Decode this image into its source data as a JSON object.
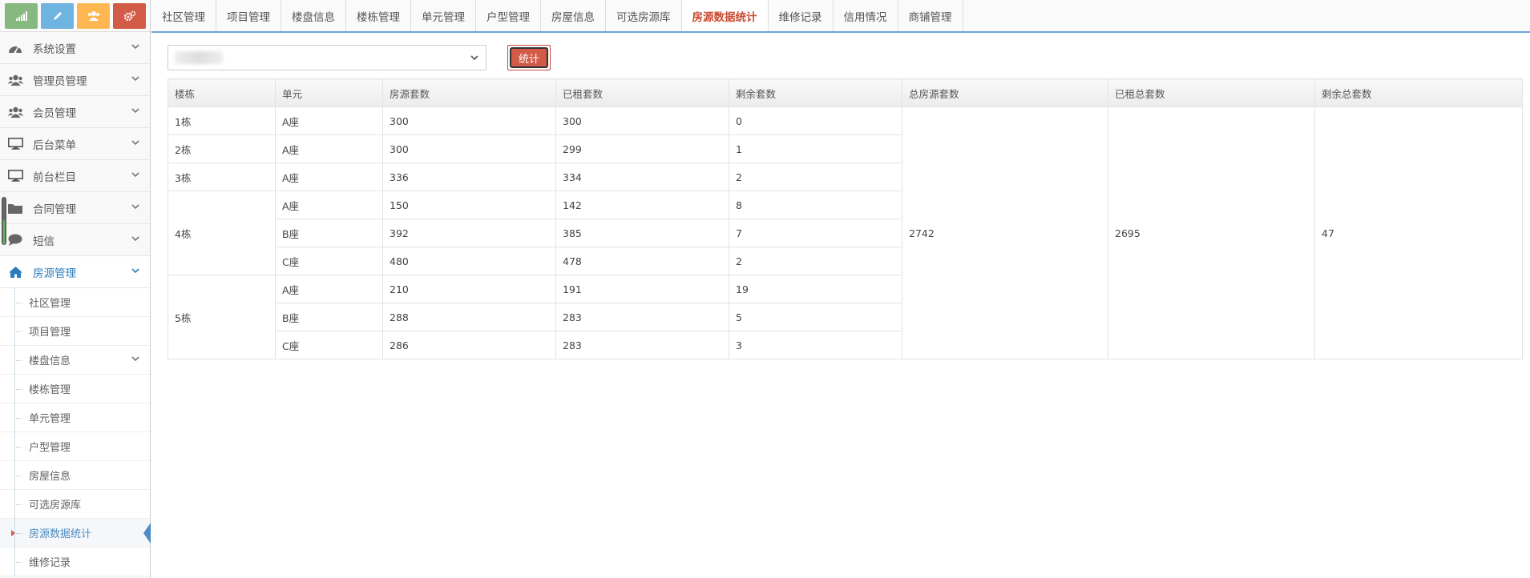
{
  "sidebar": {
    "menu": [
      {
        "label": "系统设置",
        "icon": "dashboard-icon"
      },
      {
        "label": "管理员管理",
        "icon": "users-icon"
      },
      {
        "label": "会员管理",
        "icon": "users-icon"
      },
      {
        "label": "后台菜单",
        "icon": "desktop-icon"
      },
      {
        "label": "前台栏目",
        "icon": "desktop-icon"
      },
      {
        "label": "合同管理",
        "icon": "folder-icon"
      },
      {
        "label": "短信",
        "icon": "comment-icon"
      },
      {
        "label": "房源管理",
        "icon": "home-icon"
      }
    ],
    "submenu": [
      "社区管理",
      "项目管理",
      "楼盘信息",
      "楼栋管理",
      "单元管理",
      "户型管理",
      "房屋信息",
      "可选房源库",
      "房源数据统计",
      "维修记录"
    ]
  },
  "tabs": [
    "社区管理",
    "项目管理",
    "楼盘信息",
    "楼栋管理",
    "单元管理",
    "户型管理",
    "房屋信息",
    "可选房源库",
    "房源数据统计",
    "维修记录",
    "信用情况",
    "商铺管理"
  ],
  "active_tab": "房源数据统计",
  "toolbar": {
    "stat_button": "统计"
  },
  "table": {
    "headers": [
      "楼栋",
      "单元",
      "房源套数",
      "已租套数",
      "剩余套数",
      "总房源套数",
      "已租总套数",
      "剩余总套数"
    ],
    "buildings": [
      {
        "name": "1栋",
        "units": [
          {
            "unit": "A座",
            "total": "300",
            "rented": "300",
            "remaining": "0"
          }
        ]
      },
      {
        "name": "2栋",
        "units": [
          {
            "unit": "A座",
            "total": "300",
            "rented": "299",
            "remaining": "1"
          }
        ]
      },
      {
        "name": "3栋",
        "units": [
          {
            "unit": "A座",
            "total": "336",
            "rented": "334",
            "remaining": "2"
          }
        ]
      },
      {
        "name": "4栋",
        "units": [
          {
            "unit": "A座",
            "total": "150",
            "rented": "142",
            "remaining": "8"
          },
          {
            "unit": "B座",
            "total": "392",
            "rented": "385",
            "remaining": "7"
          },
          {
            "unit": "C座",
            "total": "480",
            "rented": "478",
            "remaining": "2"
          }
        ]
      },
      {
        "name": "5栋",
        "units": [
          {
            "unit": "A座",
            "total": "210",
            "rented": "191",
            "remaining": "19"
          },
          {
            "unit": "B座",
            "total": "288",
            "rented": "283",
            "remaining": "5"
          },
          {
            "unit": "C座",
            "total": "286",
            "rented": "283",
            "remaining": "3"
          }
        ]
      }
    ],
    "summary": {
      "total": "2742",
      "rented_total": "2695",
      "remaining_total": "47"
    }
  },
  "colors": {
    "accent": "#d15b47",
    "active_link": "#2b7dbc",
    "tab_border": "#6fa3d5"
  }
}
